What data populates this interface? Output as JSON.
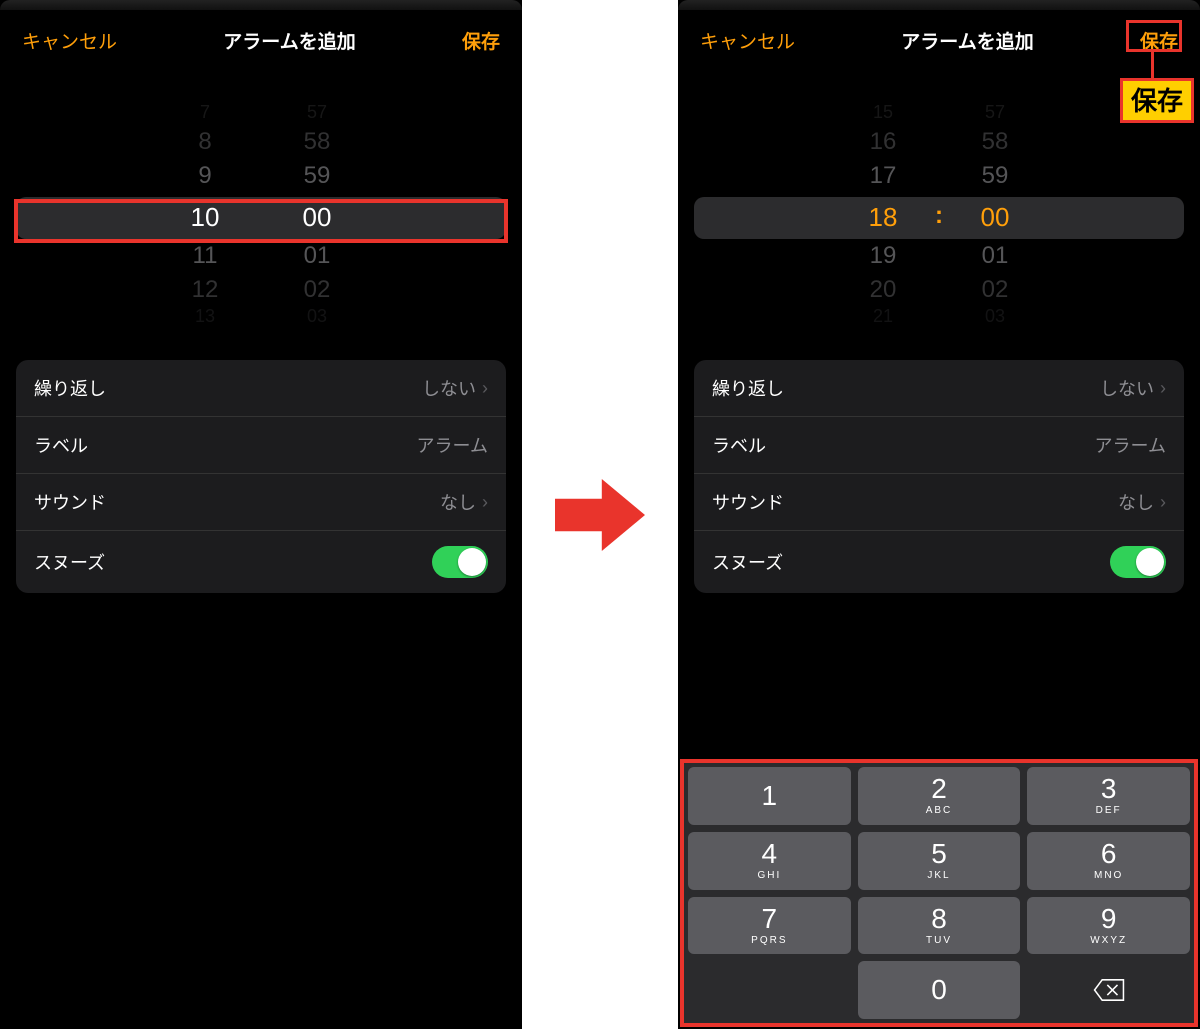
{
  "header": {
    "cancel": "キャンセル",
    "title": "アラームを追加",
    "save": "保存"
  },
  "picker_left": {
    "hours": [
      "7",
      "8",
      "9",
      "10",
      "11",
      "12",
      "13"
    ],
    "minutes": [
      "57",
      "58",
      "59",
      "00",
      "01",
      "02",
      "03"
    ]
  },
  "picker_right": {
    "hours": [
      "15",
      "16",
      "17",
      "18",
      "19",
      "20",
      "21"
    ],
    "minutes": [
      "57",
      "58",
      "59",
      "00",
      "01",
      "02",
      "03"
    ],
    "colon": ":"
  },
  "settings": {
    "repeat_label": "繰り返し",
    "repeat_value": "しない",
    "label_label": "ラベル",
    "label_value": "アラーム",
    "sound_label": "サウンド",
    "sound_value": "なし",
    "snooze_label": "スヌーズ",
    "snooze_on": true
  },
  "keypad": {
    "keys": [
      {
        "n": "1",
        "s": ""
      },
      {
        "n": "2",
        "s": "ABC"
      },
      {
        "n": "3",
        "s": "DEF"
      },
      {
        "n": "4",
        "s": "GHI"
      },
      {
        "n": "5",
        "s": "JKL"
      },
      {
        "n": "6",
        "s": "MNO"
      },
      {
        "n": "7",
        "s": "PQRS"
      },
      {
        "n": "8",
        "s": "TUV"
      },
      {
        "n": "9",
        "s": "WXYZ"
      },
      {
        "n": "",
        "s": ""
      },
      {
        "n": "0",
        "s": ""
      },
      {
        "n": "del",
        "s": ""
      }
    ]
  },
  "callout": {
    "save": "保存"
  }
}
